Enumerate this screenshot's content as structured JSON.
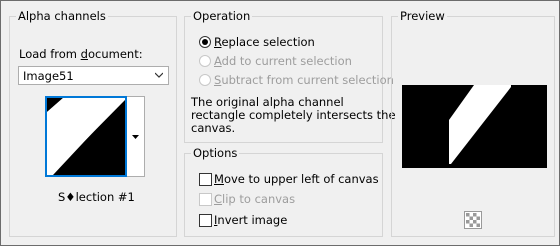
{
  "alpha_channels": {
    "title": "Alpha channels",
    "load_label_before": "Load from ",
    "load_label_underlined": "d",
    "load_label_after": "ocument:",
    "document_value": "Image51",
    "selection_name": "S♦lection #1"
  },
  "operation": {
    "title": "Operation",
    "options": [
      {
        "underlined": "R",
        "rest": "eplace selection",
        "selected": true,
        "enabled": true
      },
      {
        "underlined": "A",
        "rest": "dd to current selection",
        "selected": false,
        "enabled": false
      },
      {
        "underlined": "S",
        "rest": "ubtract from current selection",
        "selected": false,
        "enabled": false
      }
    ],
    "message_line1": "The original alpha channel",
    "message_line2": "rectangle completely intersects the",
    "message_line3": "canvas."
  },
  "options_group": {
    "title": "Options",
    "checkboxes": [
      {
        "underlined": "M",
        "rest": "ove to upper left of canvas",
        "checked": false,
        "enabled": true
      },
      {
        "underlined": "C",
        "rest": "lip to canvas",
        "checked": false,
        "enabled": false
      },
      {
        "underlined": "I",
        "rest": "nvert image",
        "checked": false,
        "enabled": true
      }
    ]
  },
  "preview": {
    "title": "Preview",
    "icons": {
      "zoom": "checker-navigate-icon"
    }
  },
  "colors": {
    "accent": "#0078d7",
    "disabled": "#9d9d9d"
  }
}
